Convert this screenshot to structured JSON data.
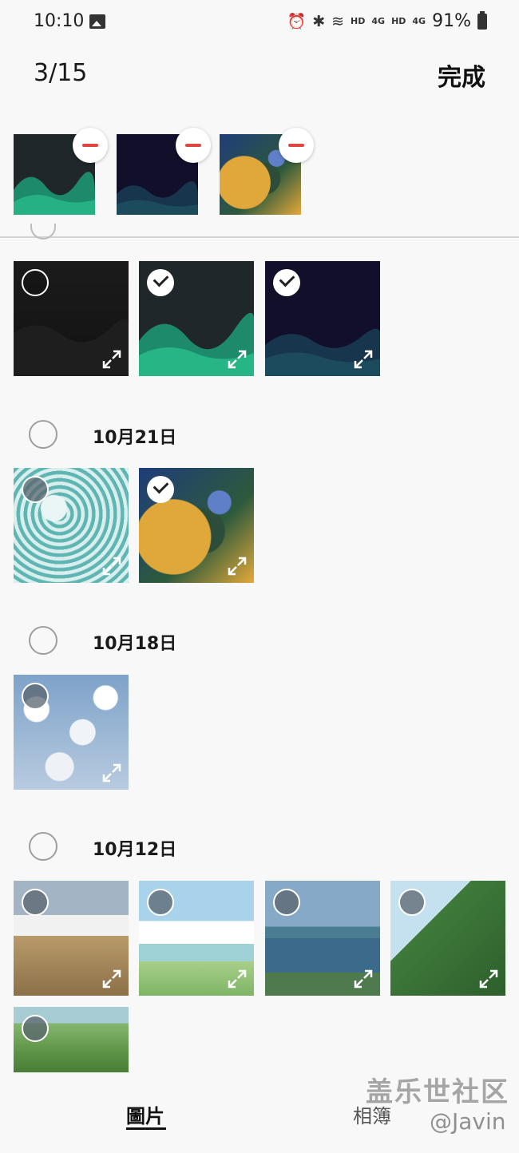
{
  "status_bar": {
    "time": "10:10",
    "battery": "91%",
    "icons": [
      "gallery-icon",
      "alarm-icon",
      "bluetooth-icon",
      "wifi-icon",
      "hd-4g-signal-icon",
      "hd-4g-signal-icon",
      "battery-icon"
    ],
    "net_labels": [
      "HD",
      "4G",
      "HD",
      "4G"
    ]
  },
  "header": {
    "counter": "3/15",
    "done_label": "完成"
  },
  "dates": [
    {
      "label": "10月21日"
    },
    {
      "label": "10月18日"
    },
    {
      "label": "10月12日"
    }
  ],
  "tabs": [
    {
      "label": "圖片",
      "active": true
    },
    {
      "label": "相簿",
      "active": false
    }
  ],
  "watermark": {
    "title": "盖乐世社区",
    "author": "@Javin"
  }
}
